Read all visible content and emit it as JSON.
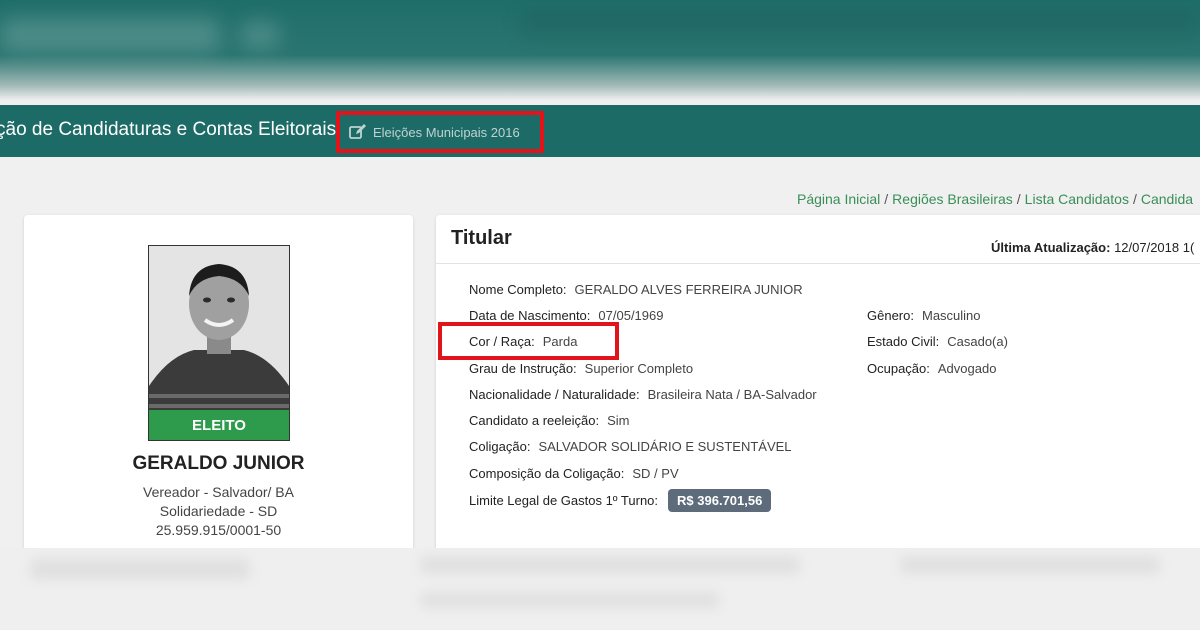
{
  "navbar": {
    "title": "ção de Candidaturas e Contas Eleitorais",
    "election_badge": "Eleições Municipais 2016"
  },
  "breadcrumb": [
    "Página Inicial",
    "Regiões Brasileiras",
    "Lista Candidatos",
    "Candida"
  ],
  "candidate": {
    "status": "ELEITO",
    "name": "GERALDO JUNIOR",
    "role": "Vereador - Salvador/ BA",
    "party": "Solidariedade - SD",
    "cnpj": "25.959.915/0001-50"
  },
  "details": {
    "title": "Titular",
    "last_update_label": "Última Atualização:",
    "last_update_value": "12/07/2018 1(",
    "fields": {
      "nome_completo": {
        "label": "Nome Completo:",
        "value": "GERALDO ALVES FERREIRA JUNIOR"
      },
      "data_nascimento": {
        "label": "Data de Nascimento:",
        "value": "07/05/1969"
      },
      "cor_raca": {
        "label": "Cor / Raça:",
        "value": "Parda"
      },
      "grau_instrucao": {
        "label": "Grau de Instrução:",
        "value": "Superior Completo"
      },
      "nacionalidade": {
        "label": "Nacionalidade / Naturalidade:",
        "value": "Brasileira Nata / BA-Salvador"
      },
      "reeleicao": {
        "label": "Candidato a reeleição:",
        "value": "Sim"
      },
      "coligacao": {
        "label": "Coligação:",
        "value": "SALVADOR SOLIDÁRIO E SUSTENTÁVEL"
      },
      "composicao": {
        "label": "Composição da Coligação:",
        "value": "SD / PV"
      },
      "limite_gastos": {
        "label": "Limite Legal de Gastos 1º Turno:",
        "value": "R$ 396.701,56"
      },
      "genero": {
        "label": "Gênero:",
        "value": "Masculino"
      },
      "estado_civil": {
        "label": "Estado Civil:",
        "value": "Casado(a)"
      },
      "ocupacao": {
        "label": "Ocupação:",
        "value": "Advogado"
      }
    }
  },
  "icons": {
    "badge_icon": "edit-icon"
  },
  "colors": {
    "nav_teal": "#1d6b67",
    "highlight_red": "#e1141b",
    "eleito_green": "#2e9b4c",
    "link_green": "#3a8e58",
    "badge_slate": "#5d6b7a"
  }
}
